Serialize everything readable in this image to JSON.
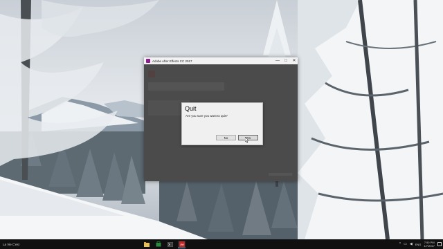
{
  "ae_window": {
    "title": "Adobe After Effects CC 2017",
    "controls": {
      "minimize": "—",
      "maximize": "□",
      "close": "✕"
    }
  },
  "dialog": {
    "title": "Quit",
    "message": "Are you sure you want to quit?",
    "no_label": "No",
    "yes_label": "Yes"
  },
  "taskbar": {
    "left_text": "La Vie C'est",
    "apps": [
      "file-explorer-icon",
      "store-icon",
      "terminal-icon",
      "after-effects-icon"
    ],
    "tray": {
      "language": "ENG",
      "time": "7:50 PM",
      "date": "1/7/2017"
    }
  },
  "colors": {
    "ae_brand": "#8e1d8e",
    "taskbar": "#101010",
    "dialog_bg": "#f0f0f0"
  }
}
